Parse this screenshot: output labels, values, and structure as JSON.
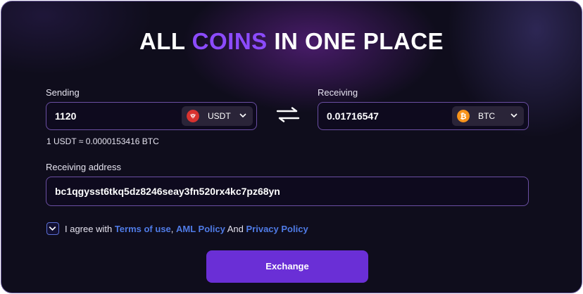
{
  "header": {
    "title_part1": "ALL ",
    "title_accent": "COINS",
    "title_part2": " IN ONE PLACE"
  },
  "sending": {
    "label": "Sending",
    "amount": "1120",
    "coin": "USDT",
    "coin_icon": "usdt-tron-icon"
  },
  "receiving": {
    "label": "Receiving",
    "amount": "0.01716547",
    "coin": "BTC",
    "coin_icon": "bitcoin-icon"
  },
  "rate": "1 USDT ≈ 0.0000153416 BTC",
  "address": {
    "label": "Receiving address",
    "value": "bc1qgysst6tkq5dz8246seay3fn520rx4kc7pz68yn"
  },
  "agreement": {
    "text1": "I agree with ",
    "terms": "Terms of use",
    "comma": ", ",
    "aml": "AML Policy",
    "and": " And ",
    "privacy": "Privacy Policy",
    "checked": true
  },
  "exchange_button": "Exchange",
  "colors": {
    "accent": "#8c4bff",
    "button": "#6a2fd6",
    "link": "#4f7be6",
    "btc": "#f7931a",
    "usdt": "#d8322f"
  }
}
